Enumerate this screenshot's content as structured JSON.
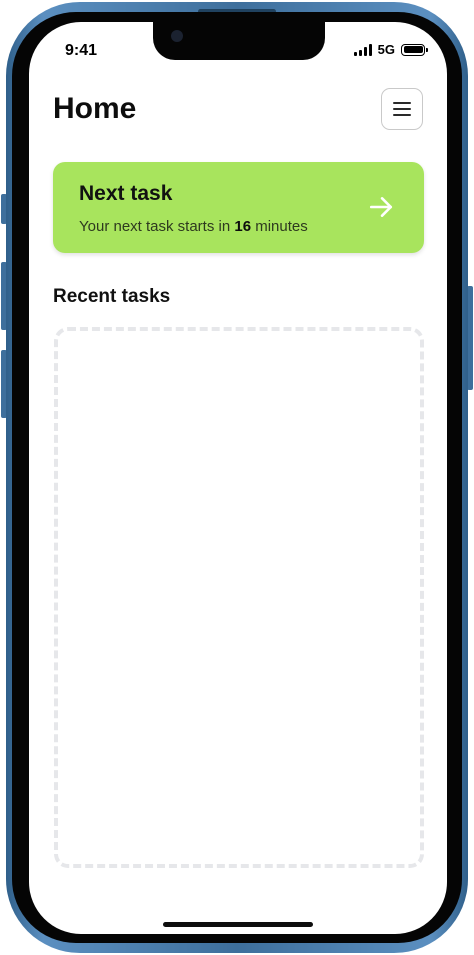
{
  "status_bar": {
    "time": "9:41",
    "network": "5G"
  },
  "header": {
    "title": "Home",
    "menu_icon": "hamburger-menu-icon"
  },
  "next_task": {
    "title": "Next task",
    "subtitle_prefix": "Your next task starts in ",
    "minutes": "16",
    "subtitle_suffix": " minutes",
    "icon": "arrow-right-icon",
    "background_color": "#a8e45d"
  },
  "recent_tasks": {
    "title": "Recent tasks",
    "items": []
  },
  "colors": {
    "frame": "#3e6f9c",
    "accent": "#a8e45d",
    "placeholder_border": "#e6e7ea"
  }
}
